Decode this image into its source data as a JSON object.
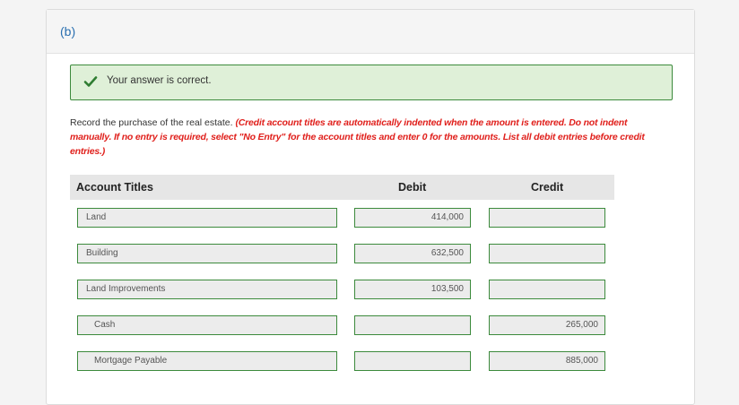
{
  "part_label": "(b)",
  "feedback": {
    "message": "Your answer is correct."
  },
  "instructions": {
    "prompt": "Record the purchase of the real estate. ",
    "note": "(Credit account titles are automatically indented when the amount is entered. Do not indent manually. If no entry is required, select \"No Entry\" for the account titles and enter 0 for the amounts. List all debit entries before credit entries.)"
  },
  "table": {
    "headers": {
      "account": "Account Titles",
      "debit": "Debit",
      "credit": "Credit"
    },
    "rows": [
      {
        "account": "Land",
        "debit": "414,000",
        "credit": ""
      },
      {
        "account": "Building",
        "debit": "632,500",
        "credit": ""
      },
      {
        "account": "Land Improvements",
        "debit": "103,500",
        "credit": ""
      },
      {
        "account": "Cash",
        "debit": "",
        "credit": "265,000"
      },
      {
        "account": "Mortgage Payable",
        "debit": "",
        "credit": "885,000"
      }
    ]
  },
  "colors": {
    "success_bg": "#dff0d8",
    "success_border": "#3c8a3c",
    "instruction_red": "#e0201c",
    "part_label_blue": "#2a6fb0"
  },
  "icons": {
    "feedback": "check-icon"
  }
}
